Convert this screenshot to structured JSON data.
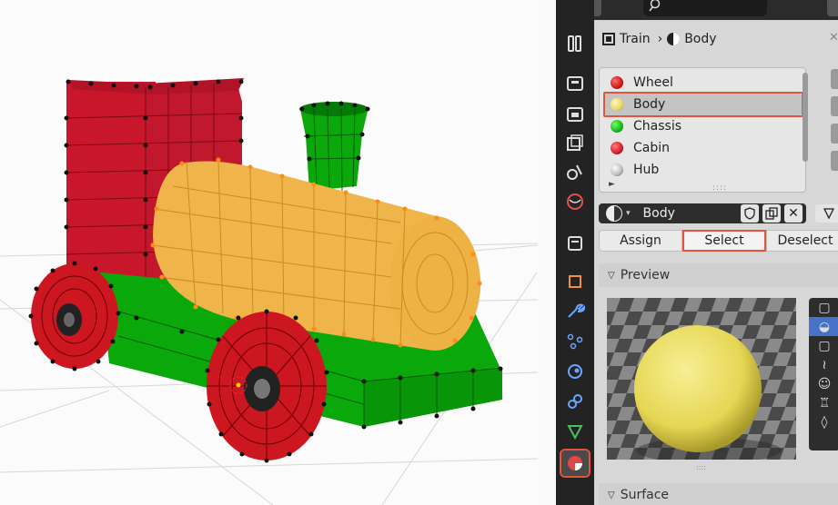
{
  "viewport": {
    "materials": {
      "wheel_color": "#cc1620",
      "cabin_color": "#c8172a",
      "chassis_color": "#0aa80a",
      "body_color": "#f0b54a",
      "vertex_color": "#111111",
      "selected_vertex_color": "#ff8a1c"
    }
  },
  "properties_tabs": [
    {
      "icon": "tool-icon",
      "active": false
    },
    {
      "icon": "render-icon",
      "active": false
    },
    {
      "icon": "output-icon",
      "active": false
    },
    {
      "icon": "view-layer-icon",
      "active": false
    },
    {
      "icon": "scene-icon",
      "active": false
    },
    {
      "icon": "world-icon",
      "active": false
    },
    {
      "icon": "collection-icon",
      "active": false
    },
    {
      "icon": "object-icon",
      "active": false
    },
    {
      "icon": "modifier-icon",
      "active": false
    },
    {
      "icon": "particles-icon",
      "active": false
    },
    {
      "icon": "physics-icon",
      "active": false
    },
    {
      "icon": "constraints-icon",
      "active": false
    },
    {
      "icon": "data-icon",
      "active": false
    },
    {
      "icon": "material-icon",
      "active": true
    }
  ],
  "breadcrumb": {
    "object": "Train",
    "separator": "›",
    "material": "Body"
  },
  "material_slots": [
    {
      "name": "Wheel",
      "color": "#cc1b1b",
      "selected": false
    },
    {
      "name": "Body",
      "color": "#e9d96b",
      "selected": true
    },
    {
      "name": "Chassis",
      "color": "#19b51a",
      "selected": false
    },
    {
      "name": "Cabin",
      "color": "#d31e2d",
      "selected": false
    },
    {
      "name": "Hub",
      "color": "#dcdcdc",
      "selected": false
    }
  ],
  "material_field": {
    "name": "Body"
  },
  "slot_ops": {
    "assign": "Assign",
    "select": "Select",
    "deselect": "Deselect"
  },
  "sections": {
    "preview": "Preview",
    "surface": "Surface"
  },
  "accent": "#e4533c"
}
